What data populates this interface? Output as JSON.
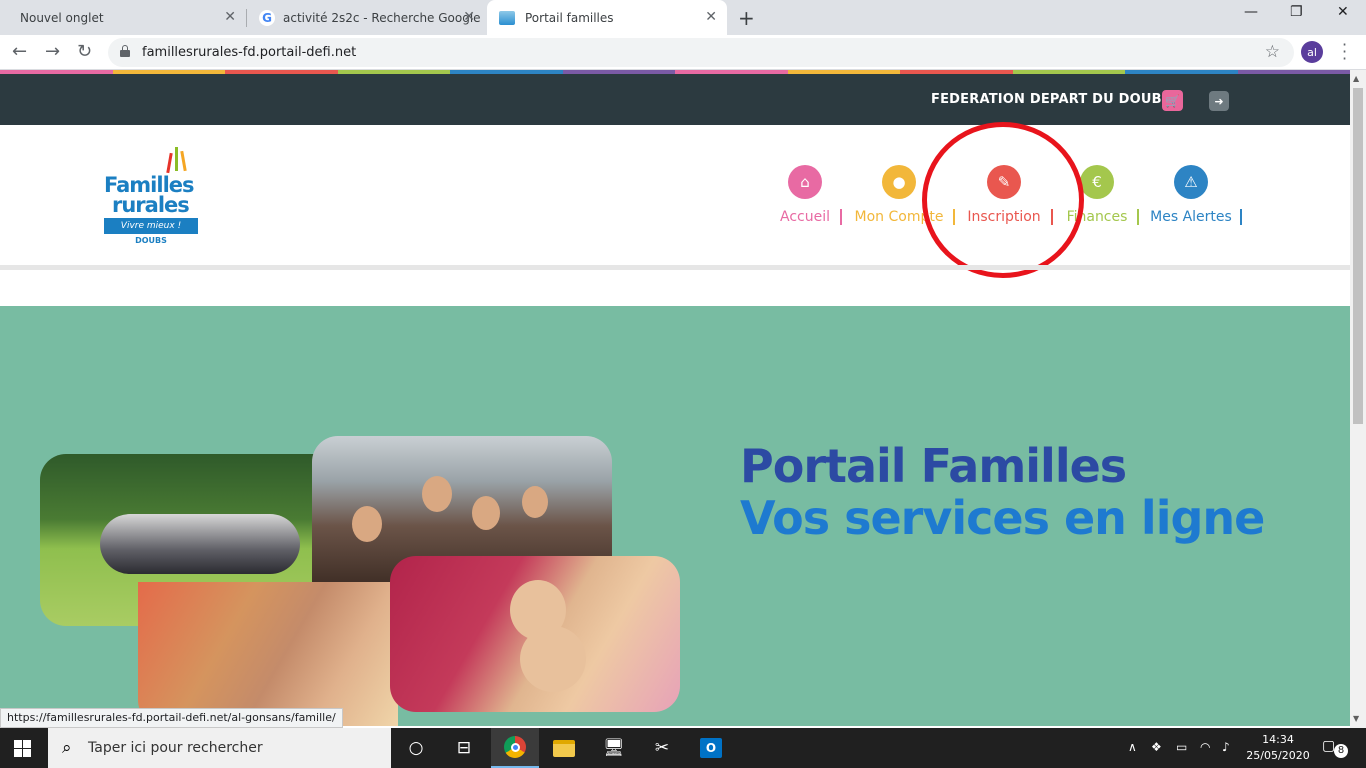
{
  "browser": {
    "tabs": [
      {
        "title": "Nouvel onglet",
        "active": false
      },
      {
        "title": "activité 2s2c - Recherche Google",
        "active": false
      },
      {
        "title": "Portail familles",
        "active": true
      }
    ],
    "url": "famillesrurales-fd.portail-defi.net",
    "profile_initials": "al",
    "status_url": "https://famillesrurales-fd.portail-defi.net/al-gonsans/famille/"
  },
  "site": {
    "top_bar": {
      "federation": "FEDERATION DEPART DU DOUBS"
    },
    "logo": {
      "line1": "Familles",
      "line2": "rurales",
      "tagline": "Vivre mieux !",
      "region": "DOUBS"
    },
    "nav": [
      {
        "label": "Accueil",
        "icon": "home-icon",
        "color": "#e86aa3"
      },
      {
        "label": "Mon Compte",
        "icon": "user-icon",
        "color": "#f2b73a"
      },
      {
        "label": "Inscription",
        "icon": "pencil-icon",
        "color": "#e9574f"
      },
      {
        "label": "Finances",
        "icon": "euro-icon",
        "color": "#a4c74d"
      },
      {
        "label": "Mes Alertes",
        "icon": "warning-icon",
        "color": "#2d84c4"
      }
    ],
    "hero": {
      "title": "Portail Familles",
      "subtitle": "Vos services en ligne",
      "background": "#78bca2"
    }
  },
  "taskbar": {
    "search_placeholder": "Taper ici pour rechercher",
    "time": "14:34",
    "date": "25/05/2020",
    "notifications": "8"
  },
  "colors": {
    "topbar": "#2c3a40",
    "highlight_circle": "#e8141c",
    "rainbow": [
      "#e86aa3",
      "#f2b73a",
      "#e9574f",
      "#a4c74d",
      "#2d84c4",
      "#7b5aa6",
      "#e86aa3",
      "#f2b73a",
      "#e9574f",
      "#a4c74d",
      "#2d84c4",
      "#7b5aa6"
    ]
  }
}
